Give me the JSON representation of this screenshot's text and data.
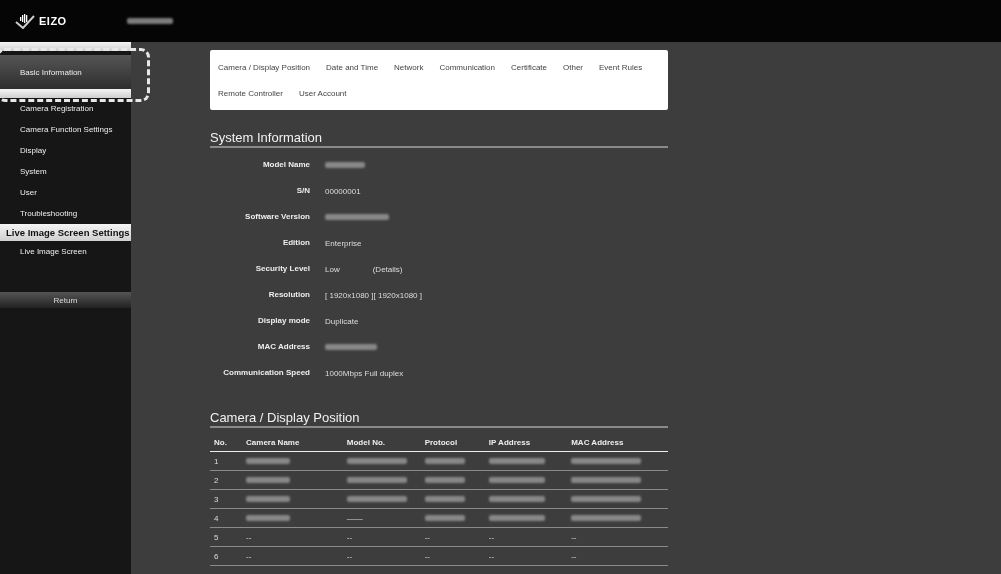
{
  "header": {
    "logo": "EIZO",
    "device_name": {
      "redacted": true
    }
  },
  "sidebar": {
    "sections": [
      {
        "items": [
          {
            "label": "Basic Information",
            "selected": true
          }
        ]
      },
      {
        "items": [
          {
            "label": "Camera Registration",
            "selected": false
          },
          {
            "label": "Camera Function Settings",
            "selected": false
          },
          {
            "label": "Display",
            "selected": false
          },
          {
            "label": "System",
            "selected": false
          },
          {
            "label": "User",
            "selected": false
          },
          {
            "label": "Troubleshooting",
            "selected": false
          }
        ]
      },
      {
        "title": "Live Image Screen Settings",
        "items": [
          {
            "label": "Live Image Screen",
            "selected": false
          }
        ]
      }
    ],
    "return_button": "Return"
  },
  "tabs": [
    "Camera / Display Position",
    "Date and Time",
    "Network",
    "Communication",
    "Certificate",
    "Other",
    "Event Rules",
    "Remote Controller",
    "User Account"
  ],
  "system_information": {
    "title": "System Information",
    "fields": [
      {
        "label": "Model Name",
        "redacted": true
      },
      {
        "label": "S/N",
        "value": "00000001"
      },
      {
        "label": "Software Version",
        "redacted": true
      },
      {
        "label": "Edition",
        "value": "Enterprise"
      },
      {
        "label": "Security Level",
        "value": "Low",
        "link": "(Details)"
      },
      {
        "label": "Resolution",
        "value": "[ 1920x1080 ][ 1920x1080 ]"
      },
      {
        "label": "Display mode",
        "value": "Duplicate"
      },
      {
        "label": "MAC Address",
        "redacted": true
      },
      {
        "label": "Communication Speed",
        "value": "1000Mbps  Full duplex"
      }
    ]
  },
  "camera_display_position": {
    "title": "Camera / Display Position",
    "columns": [
      "No.",
      "Camera Name",
      "Model No.",
      "Protocol",
      "IP Address",
      "MAC Address"
    ],
    "rows": [
      {
        "cells": [
          "1",
          null,
          null,
          null,
          null,
          null
        ]
      },
      {
        "cells": [
          "2",
          null,
          null,
          null,
          null,
          null
        ]
      },
      {
        "cells": [
          "3",
          null,
          null,
          null,
          null,
          null
        ]
      },
      {
        "cells": [
          "4",
          null,
          "——",
          null,
          null,
          null
        ]
      },
      {
        "cells": [
          "5",
          "--",
          "--",
          "--",
          "--",
          "--"
        ]
      },
      {
        "cells": [
          "6",
          "--",
          "--",
          "--",
          "--",
          "--"
        ]
      }
    ]
  }
}
